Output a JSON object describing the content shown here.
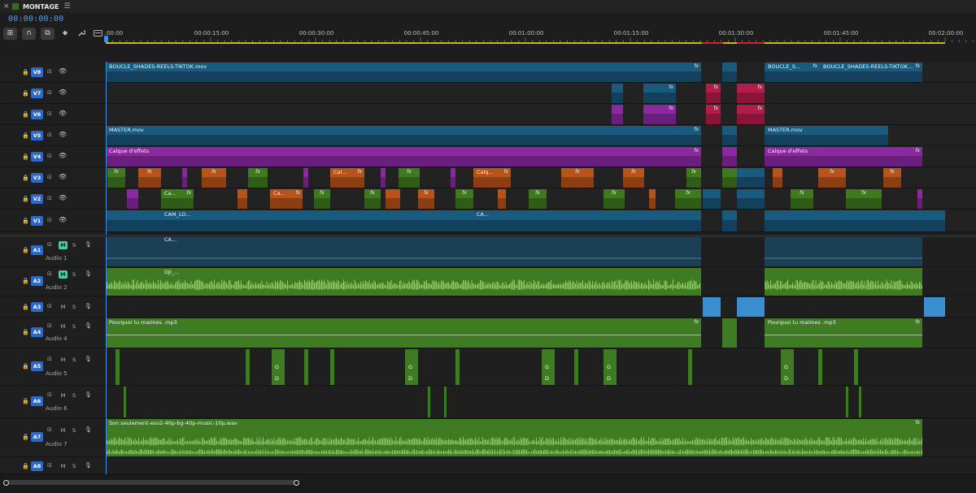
{
  "tab": {
    "close": "×",
    "title": "MONTAGE",
    "menu": "☰",
    "swatch_color": "#3b6b1f"
  },
  "timecode": "00:00:00:00",
  "toolbar": {
    "tools": [
      {
        "name": "nest-sequence-icon",
        "glyph": "⊞"
      },
      {
        "name": "snap-icon",
        "glyph": "∩"
      },
      {
        "name": "linked-selection-icon",
        "glyph": "⧉"
      },
      {
        "name": "add-marker-icon",
        "glyph": "⬥"
      },
      {
        "name": "wrench-icon",
        "glyph": "🔧"
      },
      {
        "name": "captions-icon",
        "glyph": "▭"
      }
    ]
  },
  "ruler": {
    "labels": [
      ":00:00",
      "00:00:15:00",
      "00:00:30:00",
      "00:00:45:00",
      "00:01:00:00",
      "00:01:15:00",
      "00:01:30:00",
      "00:01:45:00",
      "00:02:00:00"
    ]
  },
  "video_tracks": [
    {
      "id": "V8",
      "lock": "🔒",
      "sync": "⊟",
      "eye": "👁"
    },
    {
      "id": "V7",
      "lock": "🔒",
      "sync": "⊟",
      "eye": "👁"
    },
    {
      "id": "V6",
      "lock": "🔒",
      "sync": "⊟",
      "eye": "👁"
    },
    {
      "id": "V5",
      "lock": "🔒",
      "sync": "⊟",
      "eye": "👁"
    },
    {
      "id": "V4",
      "lock": "🔒",
      "sync": "⊟",
      "eye": "👁"
    },
    {
      "id": "V3",
      "lock": "🔒",
      "sync": "⊟",
      "eye": "👁"
    },
    {
      "id": "V2",
      "lock": "🔒",
      "sync": "⊟",
      "eye": "👁"
    },
    {
      "id": "V1",
      "lock": "🔒",
      "sync": "⊟",
      "eye": "👁"
    }
  ],
  "audio_tracks": [
    {
      "id": "A1",
      "name": "Audio 1",
      "m": "M",
      "s": "S",
      "mic": "🎙",
      "muted": true
    },
    {
      "id": "A2",
      "name": "Audio 2",
      "m": "M",
      "s": "S",
      "mic": "🎙",
      "muted": true
    },
    {
      "id": "A3",
      "name": "",
      "m": "M",
      "s": "S",
      "mic": "🎙",
      "muted": false
    },
    {
      "id": "A4",
      "name": "Audio 4",
      "m": "M",
      "s": "S",
      "mic": "🎙",
      "muted": false
    },
    {
      "id": "A5",
      "name": "Audio 5",
      "m": "M",
      "s": "S",
      "mic": "🎙",
      "muted": false
    },
    {
      "id": "A6",
      "name": "Audio 6",
      "m": "M",
      "s": "S",
      "mic": "🎙",
      "muted": false
    },
    {
      "id": "A7",
      "name": "Audio 7",
      "m": "M",
      "s": "S",
      "mic": "🎙",
      "muted": false
    },
    {
      "id": "A8",
      "name": "",
      "m": "M",
      "s": "S",
      "mic": "🎙",
      "muted": false
    }
  ],
  "clips": {
    "v8": [
      "BOUCLE_SHADES-REELS-TIKTOK.mov",
      "BOUCLE_S...",
      "BOUCLE_SHADES-REELS-TIKTOK..."
    ],
    "v5": [
      "MASTER.mov",
      "MASTER.mov"
    ],
    "v4": [
      "Calque d'effets",
      "Calque d'effets"
    ],
    "v3": [
      "Cal...",
      "Calq..."
    ],
    "v2": [
      "Ca...",
      "Ca..."
    ],
    "v1": [
      "CAM_LO...",
      "CA..."
    ],
    "a1": [
      "CA..."
    ],
    "a2": [
      "DJI_..."
    ],
    "a4": [
      "Pourquoi tu maimes .mp3",
      "Pourquoi tu maimes .mp3"
    ],
    "a5_letters": [
      "G",
      "D"
    ],
    "a7": [
      "Son seulement-esv2-40p-bg-40p-music-10p.wav"
    ],
    "fx": "fx"
  },
  "colors": {
    "accent": "#3d8fe6",
    "video_blue": "#195a7f",
    "adjustment_purple": "#8b2aa0",
    "orange": "#b8541a",
    "green": "#3f7a1e",
    "pink": "#b21d4b",
    "audio_green": "#3e7b22",
    "mute_on": "#53c9a0",
    "workbar": "#c8b820"
  }
}
